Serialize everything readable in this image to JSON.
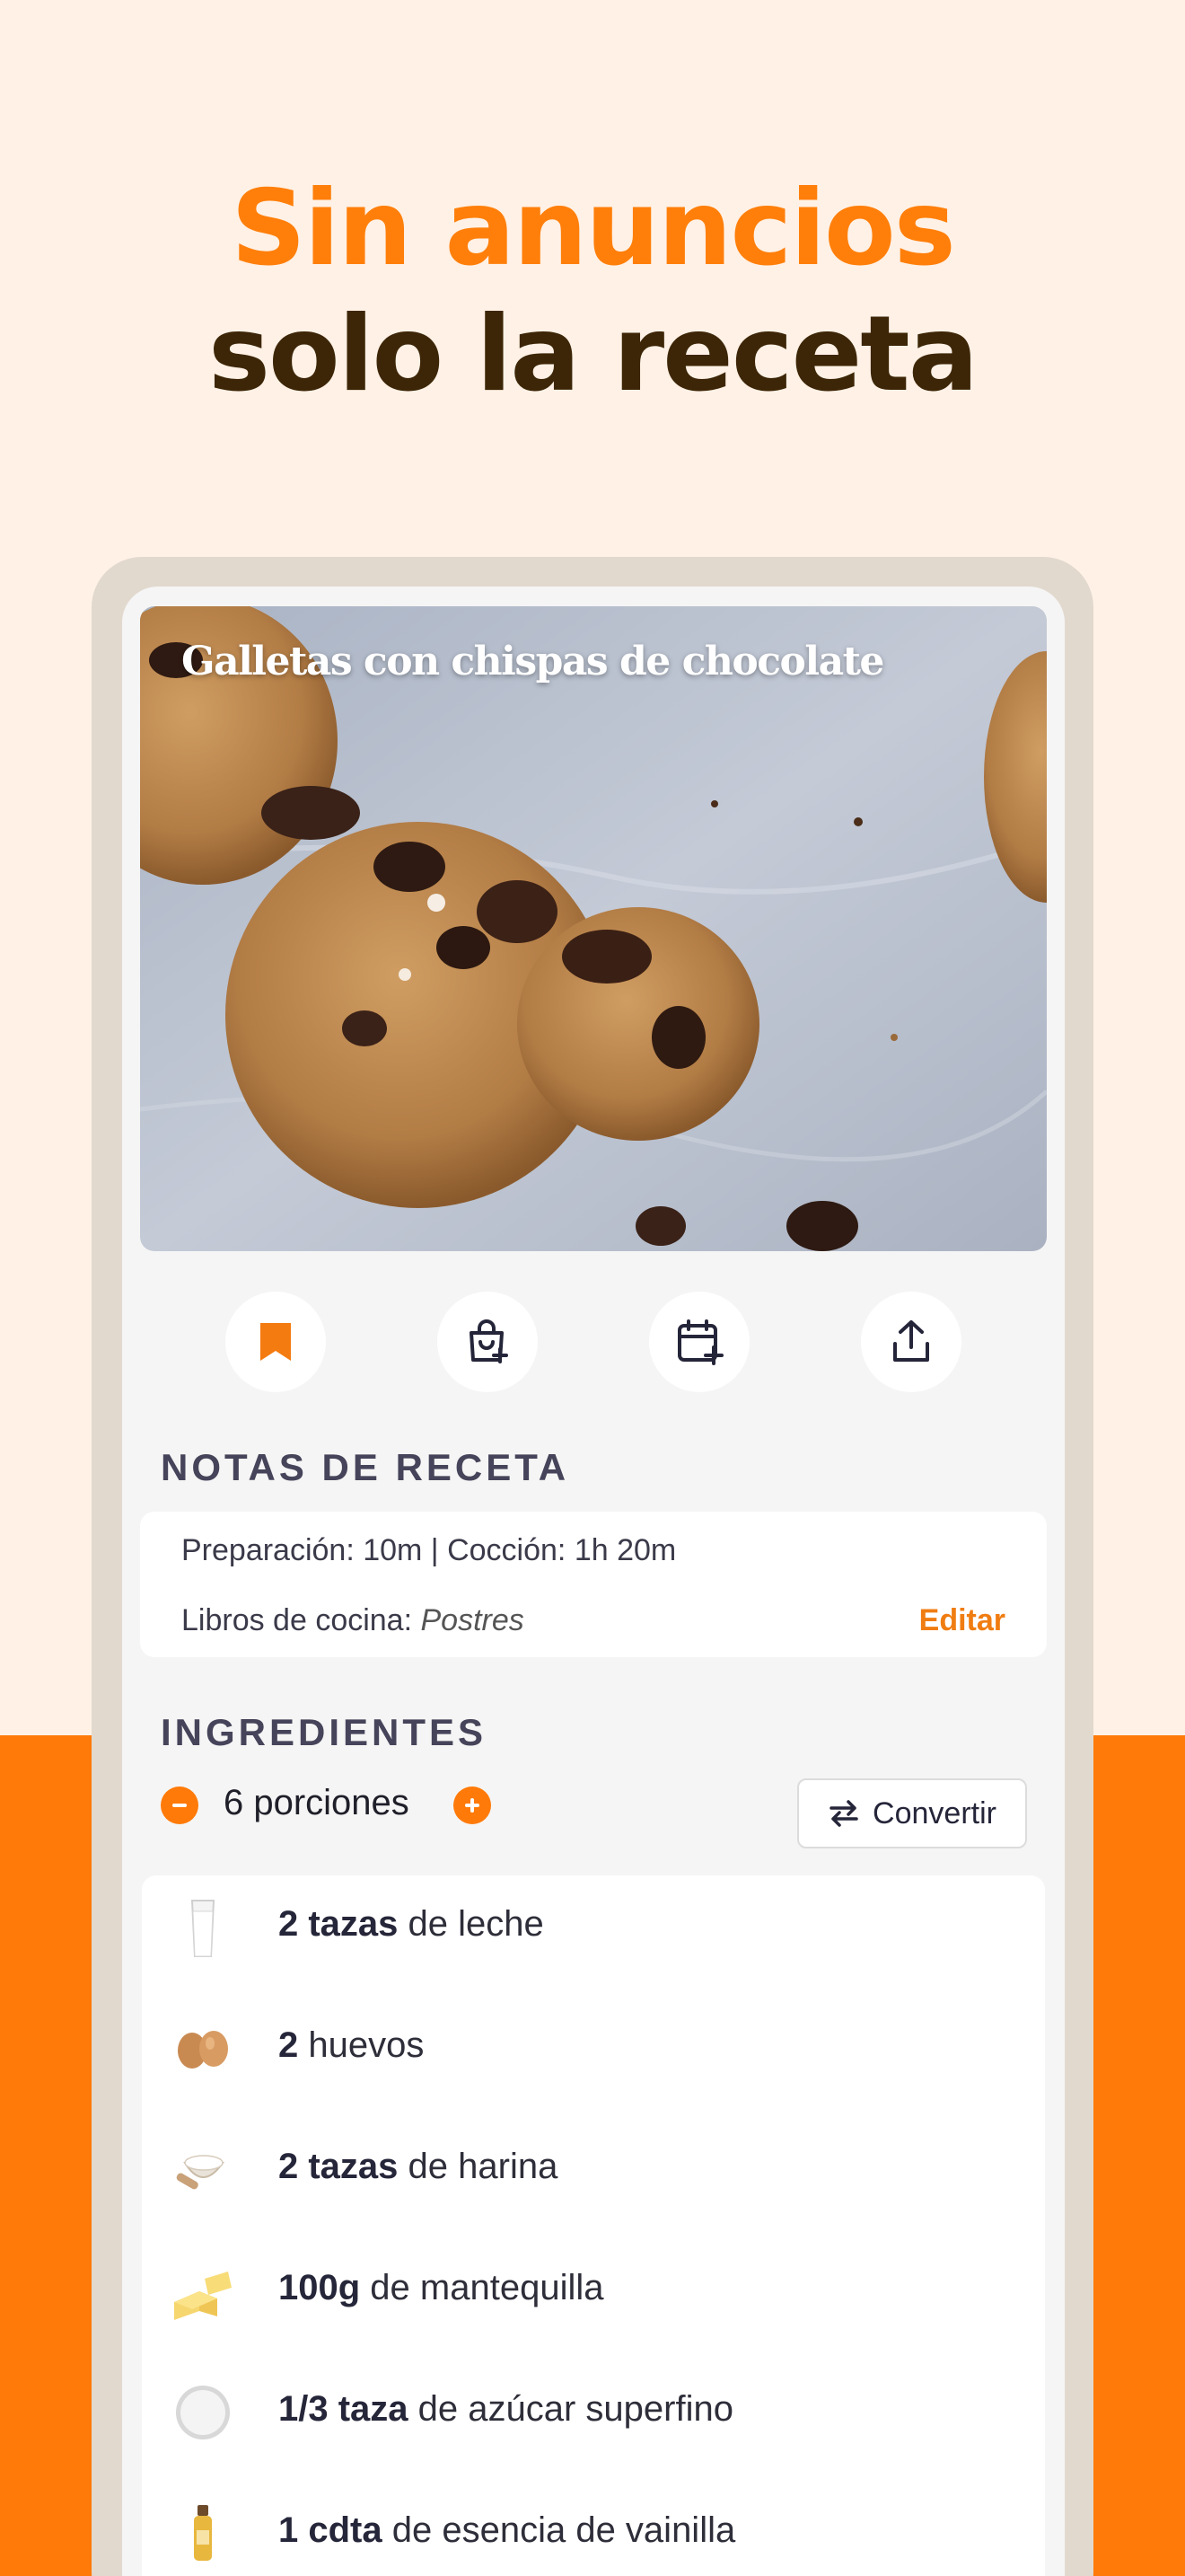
{
  "headline": {
    "line1": "Sin anuncios",
    "line2": "solo la receta"
  },
  "colors": {
    "accent": "#ff7a08",
    "background": "#fff1e6",
    "headline_dark": "#3d2607"
  },
  "recipe": {
    "title": "Galletas con chispas de chocolate"
  },
  "actions": [
    {
      "icon": "bookmark-icon"
    },
    {
      "icon": "shopping-bag-add-icon"
    },
    {
      "icon": "calendar-add-icon"
    },
    {
      "icon": "share-icon"
    }
  ],
  "notes": {
    "section_title": "NOTAS DE RECETA",
    "times": "Preparación: 10m | Cocción: 1h 20m",
    "cookbooks_label": "Libros de cocina:",
    "cookbooks_value": "Postres",
    "edit_label": "Editar"
  },
  "ingredients": {
    "section_title": "INGREDIENTES",
    "servings_label": "6 porciones",
    "convert_label": "Convertir",
    "items": [
      {
        "qty": "2 tazas",
        "text": "de leche",
        "icon": "milk-glass-icon"
      },
      {
        "qty": "2",
        "text": "huevos",
        "icon": "eggs-icon"
      },
      {
        "qty": "2 tazas",
        "text": "de harina",
        "icon": "flour-bowl-icon"
      },
      {
        "qty": "100g",
        "text": "de mantequilla",
        "icon": "butter-icon"
      },
      {
        "qty": "1/3 taza",
        "text": "de azúcar superfino",
        "icon": "sugar-icon"
      },
      {
        "qty": "1 cdta",
        "text": "de esencia de vainilla",
        "icon": "vanilla-bottle-icon"
      }
    ]
  }
}
